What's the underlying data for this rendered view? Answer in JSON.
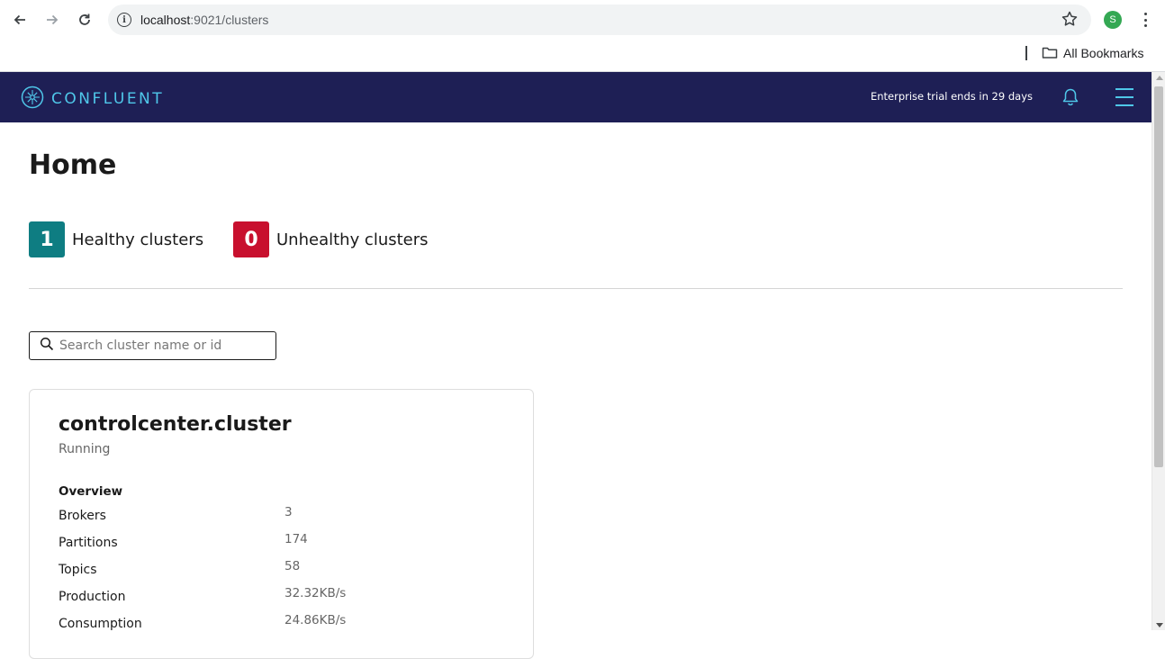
{
  "browser": {
    "url_host": "localhost",
    "url_path": ":9021/clusters",
    "profile_initial": "S",
    "bookmarks_label": "All Bookmarks"
  },
  "header": {
    "logo_text": "CONFLUENT",
    "trial_text": "Enterprise trial ends in 29 days"
  },
  "page": {
    "title": "Home",
    "healthy": {
      "count": "1",
      "label": "Healthy clusters",
      "color": "#0e7d82"
    },
    "unhealthy": {
      "count": "0",
      "label": "Unhealthy clusters",
      "color": "#c8102e"
    },
    "search": {
      "placeholder": "Search cluster name or id",
      "value": ""
    }
  },
  "cluster": {
    "name": "controlcenter.cluster",
    "status": "Running",
    "overview_label": "Overview",
    "metrics": [
      {
        "label": "Brokers",
        "value": "3"
      },
      {
        "label": "Partitions",
        "value": "174"
      },
      {
        "label": "Topics",
        "value": "58"
      },
      {
        "label": "Production",
        "value": "32.32KB/s"
      },
      {
        "label": "Consumption",
        "value": "24.86KB/s"
      }
    ]
  },
  "colors": {
    "header_bg": "#1e1f55",
    "accent": "#4fc7e9"
  },
  "icons": [
    "back-arrow-icon",
    "forward-arrow-icon",
    "reload-icon",
    "info-icon",
    "bookmark-star-icon",
    "kebab-menu-icon",
    "folder-icon",
    "confluent-logo-icon",
    "bell-icon",
    "hamburger-menu-icon",
    "search-icon"
  ]
}
